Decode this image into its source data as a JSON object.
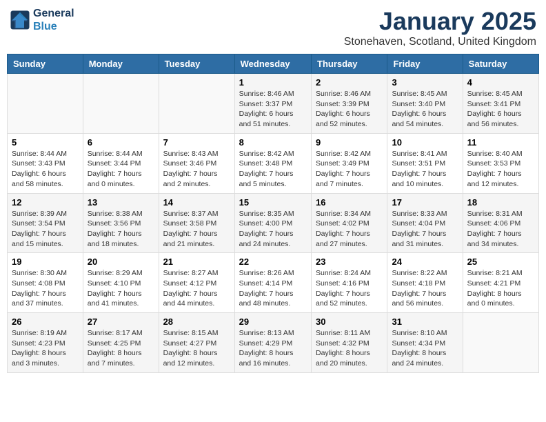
{
  "header": {
    "logo_line1": "General",
    "logo_line2": "Blue",
    "month": "January 2025",
    "location": "Stonehaven, Scotland, United Kingdom"
  },
  "weekdays": [
    "Sunday",
    "Monday",
    "Tuesday",
    "Wednesday",
    "Thursday",
    "Friday",
    "Saturday"
  ],
  "weeks": [
    [
      {
        "day": "",
        "info": ""
      },
      {
        "day": "",
        "info": ""
      },
      {
        "day": "",
        "info": ""
      },
      {
        "day": "1",
        "info": "Sunrise: 8:46 AM\nSunset: 3:37 PM\nDaylight: 6 hours and 51 minutes."
      },
      {
        "day": "2",
        "info": "Sunrise: 8:46 AM\nSunset: 3:39 PM\nDaylight: 6 hours and 52 minutes."
      },
      {
        "day": "3",
        "info": "Sunrise: 8:45 AM\nSunset: 3:40 PM\nDaylight: 6 hours and 54 minutes."
      },
      {
        "day": "4",
        "info": "Sunrise: 8:45 AM\nSunset: 3:41 PM\nDaylight: 6 hours and 56 minutes."
      }
    ],
    [
      {
        "day": "5",
        "info": "Sunrise: 8:44 AM\nSunset: 3:43 PM\nDaylight: 6 hours and 58 minutes."
      },
      {
        "day": "6",
        "info": "Sunrise: 8:44 AM\nSunset: 3:44 PM\nDaylight: 7 hours and 0 minutes."
      },
      {
        "day": "7",
        "info": "Sunrise: 8:43 AM\nSunset: 3:46 PM\nDaylight: 7 hours and 2 minutes."
      },
      {
        "day": "8",
        "info": "Sunrise: 8:42 AM\nSunset: 3:48 PM\nDaylight: 7 hours and 5 minutes."
      },
      {
        "day": "9",
        "info": "Sunrise: 8:42 AM\nSunset: 3:49 PM\nDaylight: 7 hours and 7 minutes."
      },
      {
        "day": "10",
        "info": "Sunrise: 8:41 AM\nSunset: 3:51 PM\nDaylight: 7 hours and 10 minutes."
      },
      {
        "day": "11",
        "info": "Sunrise: 8:40 AM\nSunset: 3:53 PM\nDaylight: 7 hours and 12 minutes."
      }
    ],
    [
      {
        "day": "12",
        "info": "Sunrise: 8:39 AM\nSunset: 3:54 PM\nDaylight: 7 hours and 15 minutes."
      },
      {
        "day": "13",
        "info": "Sunrise: 8:38 AM\nSunset: 3:56 PM\nDaylight: 7 hours and 18 minutes."
      },
      {
        "day": "14",
        "info": "Sunrise: 8:37 AM\nSunset: 3:58 PM\nDaylight: 7 hours and 21 minutes."
      },
      {
        "day": "15",
        "info": "Sunrise: 8:35 AM\nSunset: 4:00 PM\nDaylight: 7 hours and 24 minutes."
      },
      {
        "day": "16",
        "info": "Sunrise: 8:34 AM\nSunset: 4:02 PM\nDaylight: 7 hours and 27 minutes."
      },
      {
        "day": "17",
        "info": "Sunrise: 8:33 AM\nSunset: 4:04 PM\nDaylight: 7 hours and 31 minutes."
      },
      {
        "day": "18",
        "info": "Sunrise: 8:31 AM\nSunset: 4:06 PM\nDaylight: 7 hours and 34 minutes."
      }
    ],
    [
      {
        "day": "19",
        "info": "Sunrise: 8:30 AM\nSunset: 4:08 PM\nDaylight: 7 hours and 37 minutes."
      },
      {
        "day": "20",
        "info": "Sunrise: 8:29 AM\nSunset: 4:10 PM\nDaylight: 7 hours and 41 minutes."
      },
      {
        "day": "21",
        "info": "Sunrise: 8:27 AM\nSunset: 4:12 PM\nDaylight: 7 hours and 44 minutes."
      },
      {
        "day": "22",
        "info": "Sunrise: 8:26 AM\nSunset: 4:14 PM\nDaylight: 7 hours and 48 minutes."
      },
      {
        "day": "23",
        "info": "Sunrise: 8:24 AM\nSunset: 4:16 PM\nDaylight: 7 hours and 52 minutes."
      },
      {
        "day": "24",
        "info": "Sunrise: 8:22 AM\nSunset: 4:18 PM\nDaylight: 7 hours and 56 minutes."
      },
      {
        "day": "25",
        "info": "Sunrise: 8:21 AM\nSunset: 4:21 PM\nDaylight: 8 hours and 0 minutes."
      }
    ],
    [
      {
        "day": "26",
        "info": "Sunrise: 8:19 AM\nSunset: 4:23 PM\nDaylight: 8 hours and 3 minutes."
      },
      {
        "day": "27",
        "info": "Sunrise: 8:17 AM\nSunset: 4:25 PM\nDaylight: 8 hours and 7 minutes."
      },
      {
        "day": "28",
        "info": "Sunrise: 8:15 AM\nSunset: 4:27 PM\nDaylight: 8 hours and 12 minutes."
      },
      {
        "day": "29",
        "info": "Sunrise: 8:13 AM\nSunset: 4:29 PM\nDaylight: 8 hours and 16 minutes."
      },
      {
        "day": "30",
        "info": "Sunrise: 8:11 AM\nSunset: 4:32 PM\nDaylight: 8 hours and 20 minutes."
      },
      {
        "day": "31",
        "info": "Sunrise: 8:10 AM\nSunset: 4:34 PM\nDaylight: 8 hours and 24 minutes."
      },
      {
        "day": "",
        "info": ""
      }
    ]
  ]
}
